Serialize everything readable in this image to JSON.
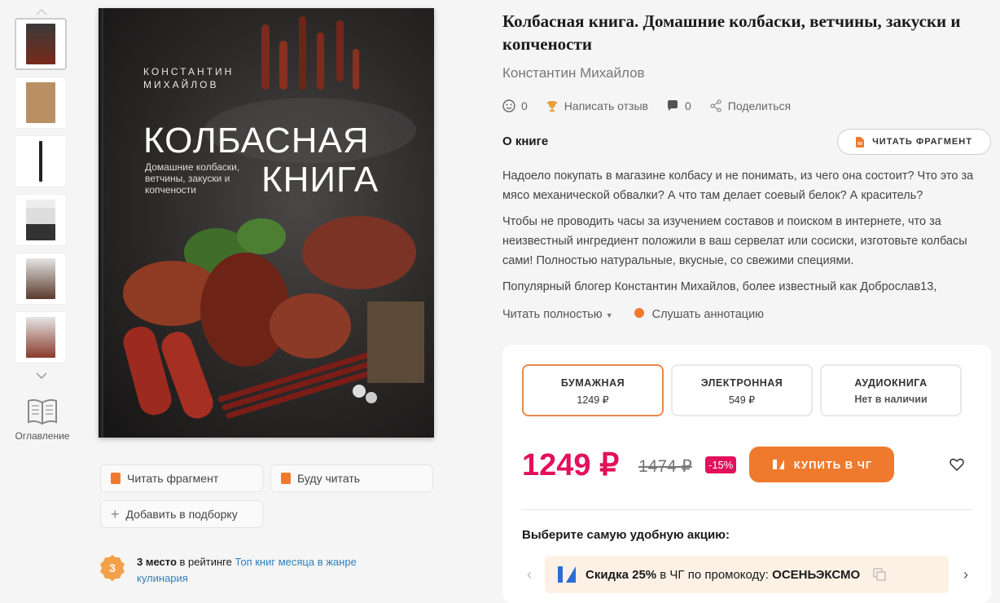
{
  "thumbnails": {
    "up_icon": "chevron-up-icon",
    "down_icon": "chevron-down-icon",
    "count": 6
  },
  "toc_label": "Оглавление",
  "cover": {
    "author": "КОНСТАНТИН МИХАЙЛОВ",
    "author_line1": "КОНСТАНТИН",
    "author_line2": "МИХАЙЛОВ",
    "title_line1": "КОЛБАСНАЯ",
    "title_line2": "КНИГА",
    "subtitle": "Домашние колбаски, ветчины, закуски и копчености"
  },
  "actions": {
    "read_fragment": "Читать фрагмент",
    "will_read": "Буду читать",
    "add_to_collection": "Добавить в подборку"
  },
  "rating": {
    "place": "3",
    "place_label": "3 место",
    "in_rating": " в рейтинге ",
    "link": "Топ книг месяца в жанре кулинария"
  },
  "book": {
    "title": "Колбасная книга. Домашние колбаски, ветчины, закуски и копчености",
    "author": "Константин Михайлов"
  },
  "meta": {
    "likes": "0",
    "review": "Написать отзыв",
    "comments": "0",
    "share": "Поделиться"
  },
  "about": {
    "heading": "О книге",
    "read_fragment_button": "ЧИТАТЬ ФРАГМЕНТ",
    "p1": "Надоело покупать в магазине колбасу и не понимать, из чего она состоит? Что это за мясо механической обвалки? А что там делает соевый белок? А краситель?",
    "p2": "Чтобы не проводить часы за изучением составов и поиском в интернете, что за неизвестный ингредиент положили в ваш сервелат или сосиски, изготовьте колбасы сами! Полностью натуральные, вкусные, со свежими специями.",
    "p3": "Популярный блогер Константин Михайлов, более известный как Доброслав13,",
    "read_more": "Читать полностью",
    "listen": "Слушать аннотацию"
  },
  "formats": [
    {
      "name": "БУМАЖНАЯ",
      "price": "1249 ₽"
    },
    {
      "name": "ЭЛЕКТРОННАЯ",
      "price": "549 ₽"
    },
    {
      "name": "АУДИОКНИГА",
      "price": "Нет в наличии"
    }
  ],
  "pricing": {
    "price": "1249 ₽",
    "old_price": "1474 ₽",
    "discount": "-15%",
    "buy_button": "КУПИТЬ В ЧГ"
  },
  "promo": {
    "heading": "Выберите самую удобную акцию:",
    "discount": "Скидка 25%",
    "text": " в ЧГ по промокоду: ",
    "code": "ОСЕНЬЭКСМО"
  },
  "colors": {
    "accent": "#ef7a2d",
    "price": "#e3105a",
    "link": "#2c7fbd"
  }
}
